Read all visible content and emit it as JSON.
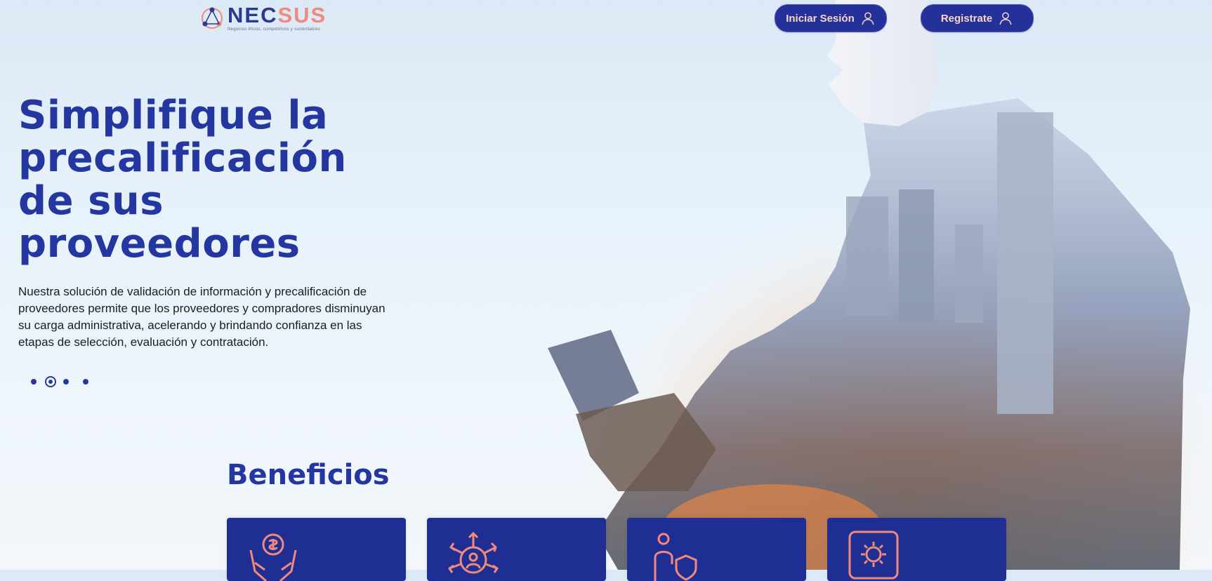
{
  "header": {
    "logo": {
      "word_part1": "NEC",
      "word_accent": "SUS",
      "tagline": "Negocios éticos, competitivos y sustentables"
    },
    "login_label": "Iniciar Sesión",
    "register_label": "Registrate"
  },
  "hero": {
    "title": "Simplifique la precalificación de sus proveedores",
    "description": "Nuestra solución de validación de información y precalificación de proveedores permite que los proveedores y compradores disminuyan su carga administrativa, acelerando y brindando confianza en las etapas de selección, evaluación y contratación.",
    "carousel": {
      "total": 4,
      "active_index": 1
    }
  },
  "benefits": {
    "title": "Beneficios",
    "cards": [
      {
        "icon": "money-hands-icon"
      },
      {
        "icon": "network-people-icon"
      },
      {
        "icon": "person-shield-icon"
      },
      {
        "icon": "gear-screen-icon"
      }
    ]
  },
  "colors": {
    "brand_blue": "#2436a0",
    "card_blue": "#1f2e93",
    "accent_coral": "#f08a7c",
    "button_text": "#fbd4c7"
  }
}
